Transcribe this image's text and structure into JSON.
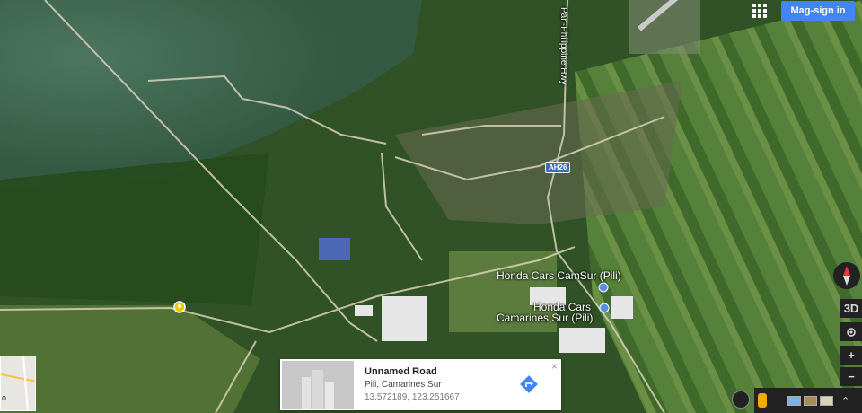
{
  "header": {
    "signin_label": "Mag-sign in",
    "apps_icon": "apps-grid-icon"
  },
  "map": {
    "highway_label": "Pan-Philippine Hwy",
    "route_shield": "AH26",
    "place_1": "Honda Cars CamSur (Pili)",
    "place_2_line1": "Honda Cars",
    "place_2_line2": "Camarines Sur (Pili)",
    "pin_icon": "location-pin-icon"
  },
  "info_card": {
    "title": "Unnamed Road",
    "subtitle": "Pili, Camarines Sur",
    "coordinates": "13.572189, 123.251667",
    "close_label": "×",
    "directions_icon": "directions-icon",
    "thumbnail_icon": "street-view-thumbnail"
  },
  "controls": {
    "tilt_label": "3D",
    "zoom_in_label": "+",
    "zoom_out_label": "−",
    "compass_icon": "compass-icon",
    "my_location_icon": "my-location-icon",
    "expand_icon": "expand-icon"
  },
  "minimap": {
    "label": "o"
  },
  "colors": {
    "signin_blue": "#4285f4",
    "directions_blue": "#4285f4",
    "pin_yellow": "#f2c500"
  }
}
